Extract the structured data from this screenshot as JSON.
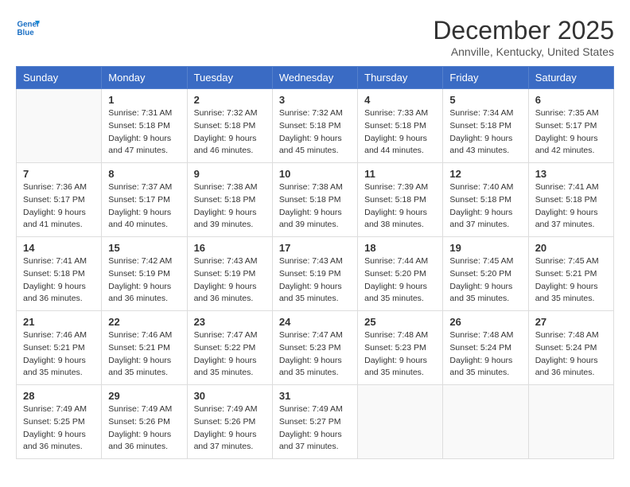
{
  "logo": {
    "line1": "General",
    "line2": "Blue"
  },
  "title": "December 2025",
  "location": "Annville, Kentucky, United States",
  "weekdays": [
    "Sunday",
    "Monday",
    "Tuesday",
    "Wednesday",
    "Thursday",
    "Friday",
    "Saturday"
  ],
  "weeks": [
    [
      {
        "day": "",
        "info": ""
      },
      {
        "day": "1",
        "info": "Sunrise: 7:31 AM\nSunset: 5:18 PM\nDaylight: 9 hours\nand 47 minutes."
      },
      {
        "day": "2",
        "info": "Sunrise: 7:32 AM\nSunset: 5:18 PM\nDaylight: 9 hours\nand 46 minutes."
      },
      {
        "day": "3",
        "info": "Sunrise: 7:32 AM\nSunset: 5:18 PM\nDaylight: 9 hours\nand 45 minutes."
      },
      {
        "day": "4",
        "info": "Sunrise: 7:33 AM\nSunset: 5:18 PM\nDaylight: 9 hours\nand 44 minutes."
      },
      {
        "day": "5",
        "info": "Sunrise: 7:34 AM\nSunset: 5:18 PM\nDaylight: 9 hours\nand 43 minutes."
      },
      {
        "day": "6",
        "info": "Sunrise: 7:35 AM\nSunset: 5:17 PM\nDaylight: 9 hours\nand 42 minutes."
      }
    ],
    [
      {
        "day": "7",
        "info": "Sunrise: 7:36 AM\nSunset: 5:17 PM\nDaylight: 9 hours\nand 41 minutes."
      },
      {
        "day": "8",
        "info": "Sunrise: 7:37 AM\nSunset: 5:17 PM\nDaylight: 9 hours\nand 40 minutes."
      },
      {
        "day": "9",
        "info": "Sunrise: 7:38 AM\nSunset: 5:18 PM\nDaylight: 9 hours\nand 39 minutes."
      },
      {
        "day": "10",
        "info": "Sunrise: 7:38 AM\nSunset: 5:18 PM\nDaylight: 9 hours\nand 39 minutes."
      },
      {
        "day": "11",
        "info": "Sunrise: 7:39 AM\nSunset: 5:18 PM\nDaylight: 9 hours\nand 38 minutes."
      },
      {
        "day": "12",
        "info": "Sunrise: 7:40 AM\nSunset: 5:18 PM\nDaylight: 9 hours\nand 37 minutes."
      },
      {
        "day": "13",
        "info": "Sunrise: 7:41 AM\nSunset: 5:18 PM\nDaylight: 9 hours\nand 37 minutes."
      }
    ],
    [
      {
        "day": "14",
        "info": "Sunrise: 7:41 AM\nSunset: 5:18 PM\nDaylight: 9 hours\nand 36 minutes."
      },
      {
        "day": "15",
        "info": "Sunrise: 7:42 AM\nSunset: 5:19 PM\nDaylight: 9 hours\nand 36 minutes."
      },
      {
        "day": "16",
        "info": "Sunrise: 7:43 AM\nSunset: 5:19 PM\nDaylight: 9 hours\nand 36 minutes."
      },
      {
        "day": "17",
        "info": "Sunrise: 7:43 AM\nSunset: 5:19 PM\nDaylight: 9 hours\nand 35 minutes."
      },
      {
        "day": "18",
        "info": "Sunrise: 7:44 AM\nSunset: 5:20 PM\nDaylight: 9 hours\nand 35 minutes."
      },
      {
        "day": "19",
        "info": "Sunrise: 7:45 AM\nSunset: 5:20 PM\nDaylight: 9 hours\nand 35 minutes."
      },
      {
        "day": "20",
        "info": "Sunrise: 7:45 AM\nSunset: 5:21 PM\nDaylight: 9 hours\nand 35 minutes."
      }
    ],
    [
      {
        "day": "21",
        "info": "Sunrise: 7:46 AM\nSunset: 5:21 PM\nDaylight: 9 hours\nand 35 minutes."
      },
      {
        "day": "22",
        "info": "Sunrise: 7:46 AM\nSunset: 5:21 PM\nDaylight: 9 hours\nand 35 minutes."
      },
      {
        "day": "23",
        "info": "Sunrise: 7:47 AM\nSunset: 5:22 PM\nDaylight: 9 hours\nand 35 minutes."
      },
      {
        "day": "24",
        "info": "Sunrise: 7:47 AM\nSunset: 5:23 PM\nDaylight: 9 hours\nand 35 minutes."
      },
      {
        "day": "25",
        "info": "Sunrise: 7:48 AM\nSunset: 5:23 PM\nDaylight: 9 hours\nand 35 minutes."
      },
      {
        "day": "26",
        "info": "Sunrise: 7:48 AM\nSunset: 5:24 PM\nDaylight: 9 hours\nand 35 minutes."
      },
      {
        "day": "27",
        "info": "Sunrise: 7:48 AM\nSunset: 5:24 PM\nDaylight: 9 hours\nand 36 minutes."
      }
    ],
    [
      {
        "day": "28",
        "info": "Sunrise: 7:49 AM\nSunset: 5:25 PM\nDaylight: 9 hours\nand 36 minutes."
      },
      {
        "day": "29",
        "info": "Sunrise: 7:49 AM\nSunset: 5:26 PM\nDaylight: 9 hours\nand 36 minutes."
      },
      {
        "day": "30",
        "info": "Sunrise: 7:49 AM\nSunset: 5:26 PM\nDaylight: 9 hours\nand 37 minutes."
      },
      {
        "day": "31",
        "info": "Sunrise: 7:49 AM\nSunset: 5:27 PM\nDaylight: 9 hours\nand 37 minutes."
      },
      {
        "day": "",
        "info": ""
      },
      {
        "day": "",
        "info": ""
      },
      {
        "day": "",
        "info": ""
      }
    ]
  ]
}
